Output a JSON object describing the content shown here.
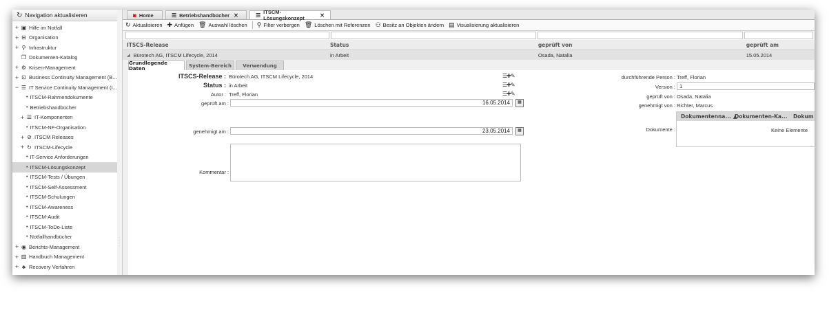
{
  "sidebar": {
    "header": "Navigation aktualisieren",
    "items": [
      {
        "label": "Hilfe im Notfall",
        "pm": "+",
        "icon": "▣",
        "level": 0
      },
      {
        "label": "Organisation",
        "pm": "+",
        "icon": "⊟",
        "level": 0
      },
      {
        "label": "Infrastruktur",
        "pm": "+",
        "icon": "⚲",
        "level": 0
      },
      {
        "label": "Dokumenten-Katalog",
        "pm": "",
        "icon": "❐",
        "level": 0
      },
      {
        "label": "Krisen-Management",
        "pm": "+",
        "icon": "⚙",
        "level": 0
      },
      {
        "label": "Business Continuity Management (B...",
        "pm": "+",
        "icon": "⊡",
        "level": 0
      },
      {
        "label": "IT Service Continuity Management (I...",
        "pm": "−",
        "icon": "☰",
        "level": 0
      },
      {
        "label": "ITSCM-Rahmendokumente",
        "pm": "",
        "icon": "•",
        "level": 2
      },
      {
        "label": "Betriebshandbücher",
        "pm": "",
        "icon": "•",
        "level": 2
      },
      {
        "label": "IT-Komponenten",
        "pm": "+",
        "icon": "☰",
        "level": 1
      },
      {
        "label": "ITSCM-NF-Organisation",
        "pm": "",
        "icon": "•",
        "level": 2
      },
      {
        "label": "ITSCM Releases",
        "pm": "+",
        "icon": "⊘",
        "level": 1
      },
      {
        "label": "ITSCM-Lifecycle",
        "pm": "+",
        "icon": "↻",
        "level": 1
      },
      {
        "label": "IT-Service Anforderungen",
        "pm": "",
        "icon": "•",
        "level": 2
      },
      {
        "label": "ITSCM-Lösungskonzept",
        "pm": "",
        "icon": "•",
        "level": 2,
        "selected": true
      },
      {
        "label": "ITSCM-Tests / Übungen",
        "pm": "",
        "icon": "•",
        "level": 2
      },
      {
        "label": "ITSCM-Self-Assessment",
        "pm": "",
        "icon": "•",
        "level": 2
      },
      {
        "label": "ITSCM-Schulungen",
        "pm": "",
        "icon": "•",
        "level": 2
      },
      {
        "label": "ITSCM-Awareness",
        "pm": "",
        "icon": "•",
        "level": 2
      },
      {
        "label": "ITSCM-Audit",
        "pm": "",
        "icon": "•",
        "level": 2
      },
      {
        "label": "ITSCM-ToDo-Liste",
        "pm": "",
        "icon": "•",
        "level": 2
      },
      {
        "label": "Notfallhandbücher",
        "pm": "",
        "icon": "•",
        "level": 2
      },
      {
        "label": "Berichts-Management",
        "pm": "+",
        "icon": "◉",
        "level": 0
      },
      {
        "label": "Handbuch Management",
        "pm": "+",
        "icon": "▥",
        "level": 0
      },
      {
        "label": "Recovery Verfahren",
        "pm": "+",
        "icon": "♣",
        "level": 0
      }
    ]
  },
  "tabs": [
    {
      "label": "Home",
      "icon": "◙",
      "closable": false
    },
    {
      "label": "Betriebshandbücher",
      "icon": "☰",
      "closable": true
    },
    {
      "label": "ITSCM-Lösungskonzept",
      "icon": "☰",
      "closable": true,
      "active": true
    }
  ],
  "toolbar": [
    {
      "label": "Aktualisieren",
      "icon": "↻"
    },
    {
      "label": "Anfügen",
      "icon": "✚"
    },
    {
      "label": "Auswahl löschen",
      "icon": "🗑"
    },
    {
      "label": "Filter verbergen",
      "icon": "⚲"
    },
    {
      "label": "Löschen mit Referenzen",
      "icon": "🗑"
    },
    {
      "label": "Besitz an Objekten ändern",
      "icon": "⚇"
    },
    {
      "label": "Visualisierung aktualisieren",
      "icon": "▤"
    }
  ],
  "grid": {
    "columns": [
      "ITSCS-Release",
      "Status",
      "geprüft von",
      "geprüft am"
    ],
    "row": {
      "release": "Bürotech AG, ITSCM Lifecycle, 2014",
      "status": "in Arbeit",
      "geprueft_von": "Osada, Natalia",
      "geprueft_am": "15.05.2014",
      "expander": "◢"
    }
  },
  "detail_tabs": [
    "Grundlegende Daten",
    "System-Bereich",
    "Verwendung"
  ],
  "form": {
    "release_label": "ITSCS-Release :",
    "release_value": "Bürotech AG, ITSCM Lifecycle, 2014",
    "status_label": "Status :",
    "status_value": "in Arbeit",
    "autor_label": "Autor :",
    "autor_value": "Treff, Florian",
    "geprueft_am_label": "geprüft am :",
    "geprueft_am_value": "16.05.2014",
    "genehmigt_am_label": "genehmigt am :",
    "genehmigt_am_value": "23.05.2014",
    "kommentar_label": "Kommentar :",
    "durchfuehrende_label": "durchführende Person :",
    "durchfuehrende_value": "Treff, Florian",
    "version_label": "Version :",
    "version_value": "1",
    "geprueft_von_label": "geprüft von :",
    "geprueft_von_value": "Osada, Natalia",
    "genehmigt_von_label": "genehmigt von :",
    "genehmigt_von_value": "Richter, Marcus",
    "dokumente_label": "Dokumente :",
    "doc_columns": [
      "Dokumentenna...",
      "Dokumenten-Ka...",
      "Dokum"
    ],
    "doc_empty": "Keine Elemente"
  }
}
